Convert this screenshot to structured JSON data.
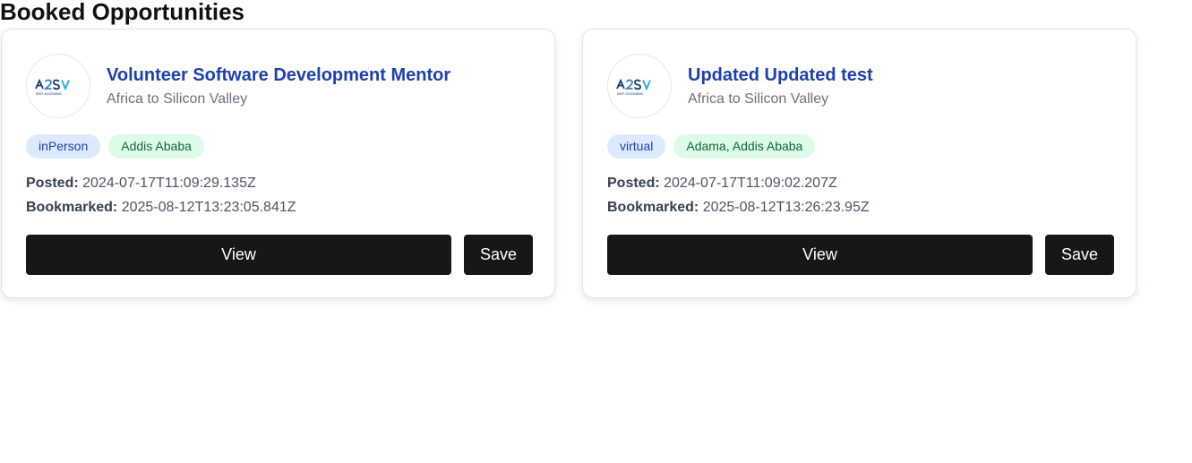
{
  "page": {
    "title": "Booked Opportunities"
  },
  "cards": [
    {
      "title": "Volunteer Software Development Mentor",
      "organization": "Africa to Silicon Valley",
      "logo_text": "A2SV",
      "logo_tagline": "KEEP ASCENDING",
      "tags": {
        "mode": "inPerson",
        "location": "Addis Ababa"
      },
      "posted_label": "Posted:",
      "posted_value": "2024-07-17T11:09:29.135Z",
      "bookmarked_label": "Bookmarked:",
      "bookmarked_value": "2025-08-12T13:23:05.841Z",
      "view_label": "View",
      "save_label": "Save"
    },
    {
      "title": "Updated Updated test",
      "organization": "Africa to Silicon Valley",
      "logo_text": "A2SV",
      "logo_tagline": "KEEP ASCENDING",
      "tags": {
        "mode": "virtual",
        "location": "Adama, Addis Ababa"
      },
      "posted_label": "Posted:",
      "posted_value": "2024-07-17T11:09:02.207Z",
      "bookmarked_label": "Bookmarked:",
      "bookmarked_value": "2025-08-12T13:26:23.95Z",
      "view_label": "View",
      "save_label": "Save"
    }
  ],
  "colors": {
    "title": "#1e40af",
    "tag_mode_bg": "#dbeafe",
    "tag_location_bg": "#dcfce7",
    "button_bg": "#171717"
  }
}
